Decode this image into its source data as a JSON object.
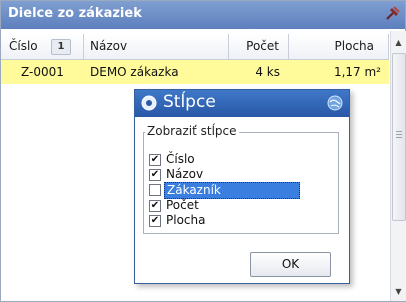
{
  "panel": {
    "title": "Dielce zo zákaziek"
  },
  "grid": {
    "columns": [
      "Číslo",
      "Názov",
      "Počet",
      "Plocha"
    ],
    "sort_indicator": "1",
    "rows": [
      {
        "cislo": "Z-0001",
        "nazov": "DEMO zákazka",
        "pocet": "4 ks",
        "plocha": "1,17 m²"
      }
    ]
  },
  "dialog": {
    "title": "Stĺpce",
    "group_label": "Zobraziť stĺpce",
    "options": [
      {
        "label": "Číslo",
        "checked": true
      },
      {
        "label": "Názov",
        "checked": true
      },
      {
        "label": "Zákazník",
        "checked": false
      },
      {
        "label": "Počet",
        "checked": true
      },
      {
        "label": "Plocha",
        "checked": true
      }
    ],
    "ok_label": "OK"
  },
  "colors": {
    "title_bar": "#6b8bc8",
    "row_highlight": "#fffb9a",
    "dialog_title": "#2f63b5",
    "selection": "#3a7fe0"
  },
  "icons": {
    "pin": "pin-icon",
    "dialog": "dialog-icon",
    "globe": "globe-icon"
  }
}
